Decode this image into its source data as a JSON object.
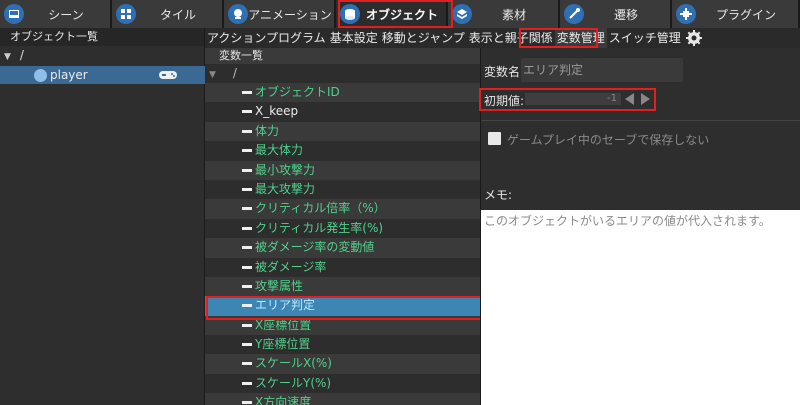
{
  "top_tabs": [
    {
      "label": "シーン",
      "icon": "scene-icon"
    },
    {
      "label": "タイル",
      "icon": "tile-icon"
    },
    {
      "label": "アニメーション",
      "icon": "animation-icon"
    },
    {
      "label": "オブジェクト",
      "icon": "object-icon",
      "active": true
    },
    {
      "label": "素材",
      "icon": "material-icon"
    },
    {
      "label": "遷移",
      "icon": "transition-icon"
    },
    {
      "label": "プラグイン",
      "icon": "plugin-icon"
    }
  ],
  "left_panel": {
    "header": "オブジェクト一覧",
    "root_label": "/",
    "object_name": "player"
  },
  "sub_tabs": [
    "アクションプログラム",
    "基本設定",
    "移動とジャンプ",
    "表示と親子関係",
    "変数管理",
    "スイッチ管理"
  ],
  "active_sub_tab": "変数管理",
  "variables": {
    "header": "変数一覧",
    "root_label": "/",
    "items": [
      "オブジェクトID",
      "X_keep",
      "体力",
      "最大体力",
      "最小攻撃力",
      "最大攻撃力",
      "クリティカル倍率（%）",
      "クリティカル発生率(%)",
      "被ダメージ率の変動値",
      "被ダメージ率",
      "攻撃属性",
      "エリア判定",
      "X座標位置",
      "Y座標位置",
      "スケールX(%)",
      "スケールY(%)",
      "X方向速度"
    ],
    "selected": "エリア判定"
  },
  "detail": {
    "name_label": "変数名:",
    "name_value": "エリア判定",
    "initial_label": "初期値:",
    "initial_value": "-1",
    "checkbox_label": "ゲームプレイ中のセーブで保存しない",
    "memo_label": "メモ:",
    "memo_text": "このオブジェクトがいるエリアの値が代入されます。"
  },
  "colors": {
    "accent_blue": "#3d86b3",
    "highlight_red": "#e02020",
    "variable_green": "#50d08a"
  }
}
